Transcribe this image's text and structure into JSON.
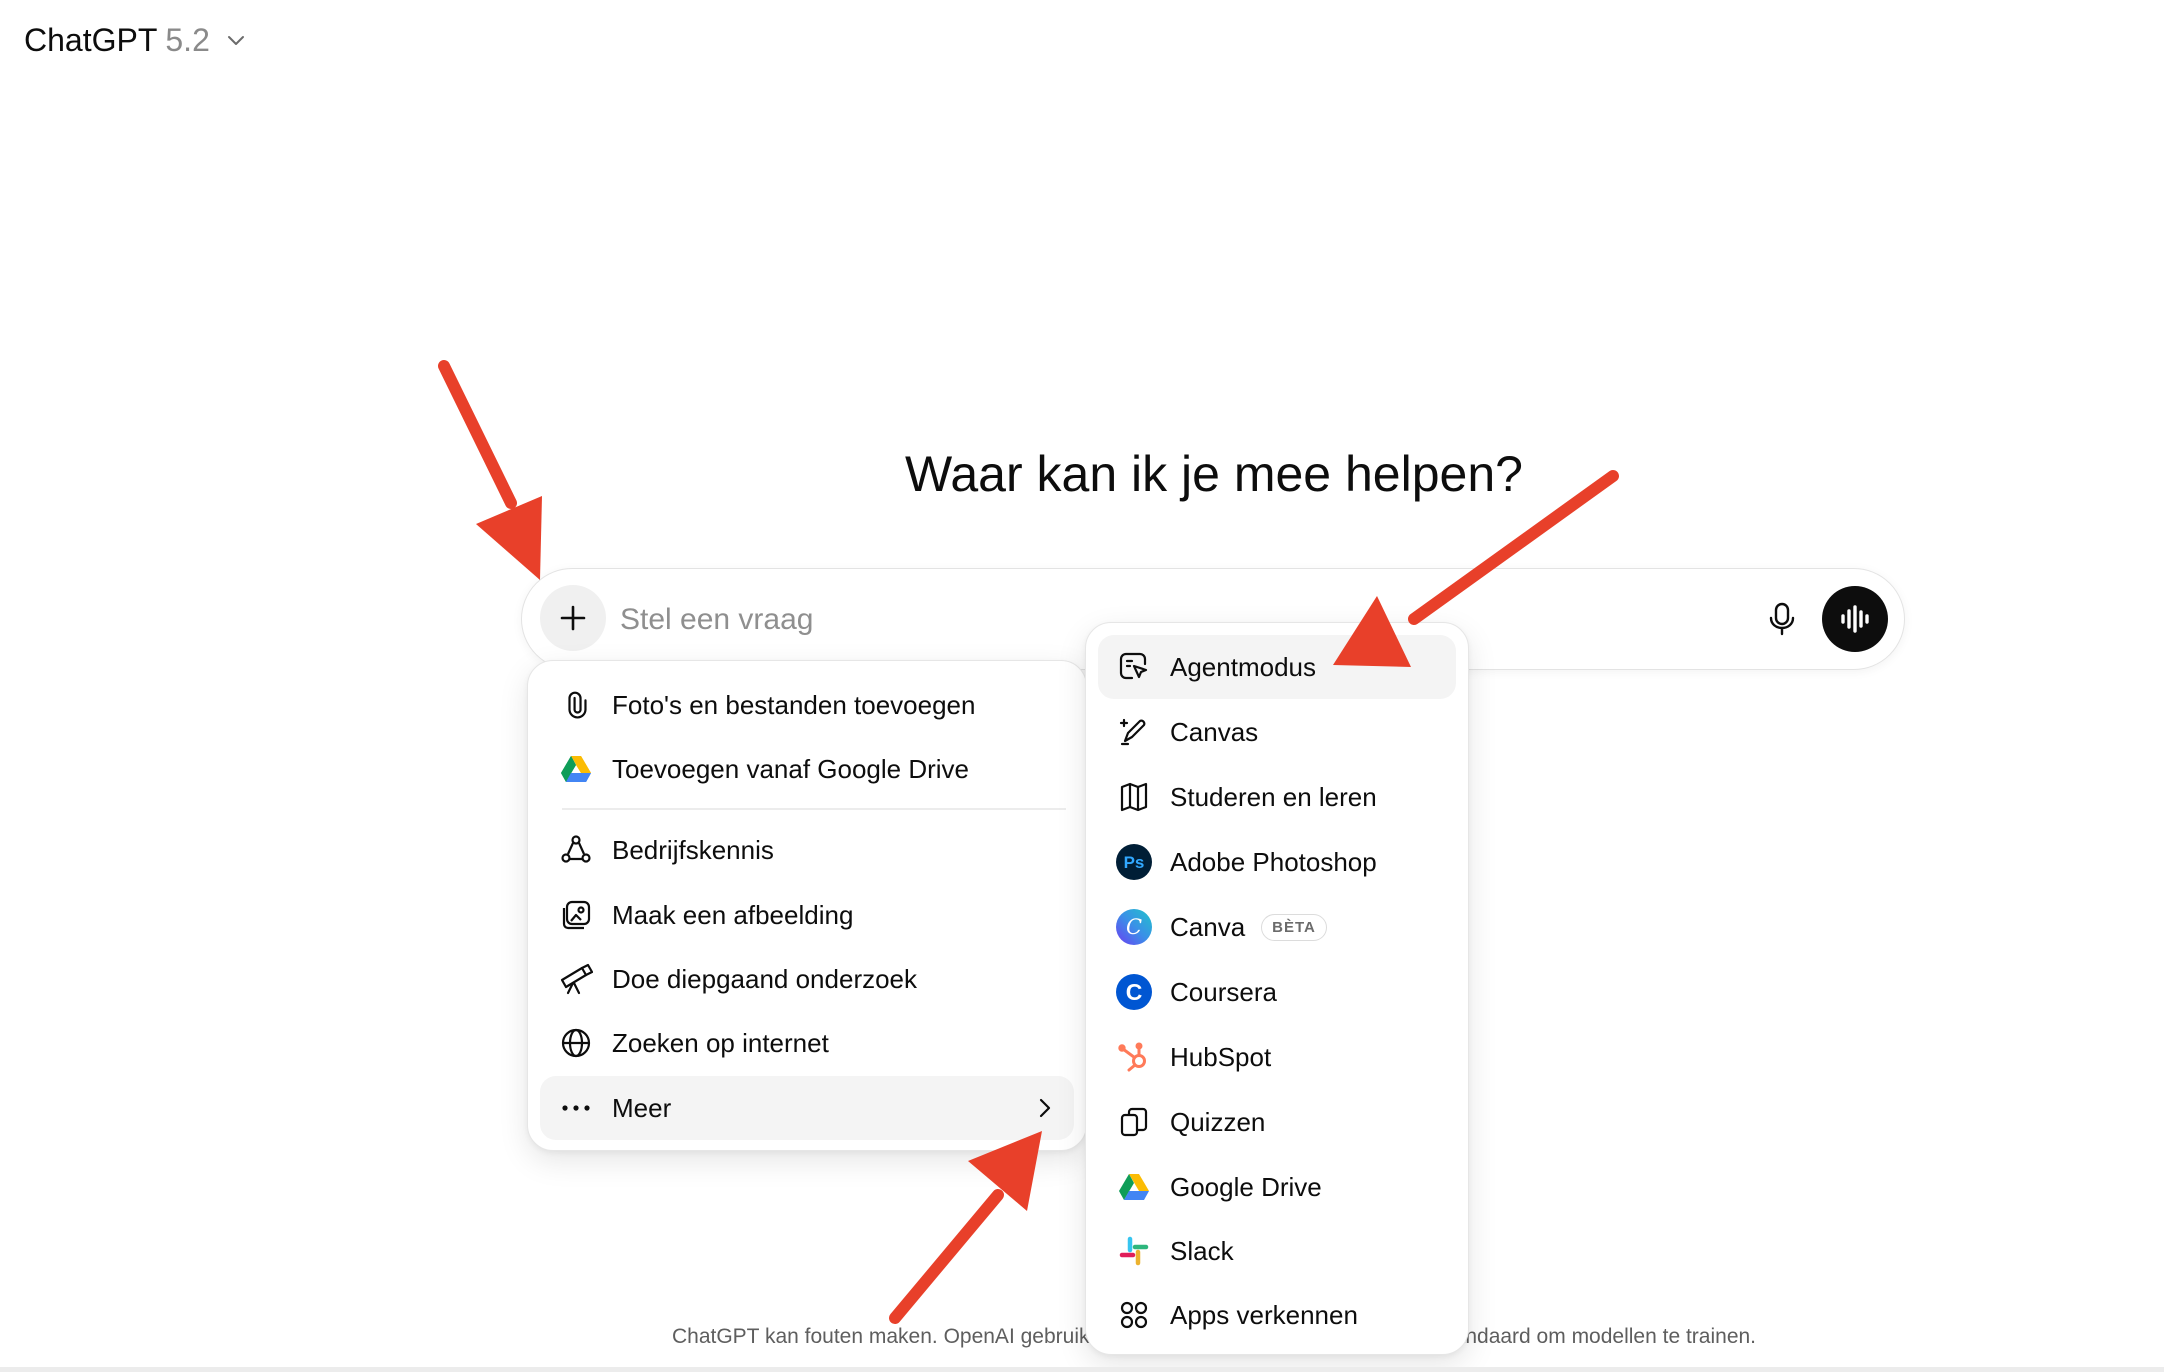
{
  "header": {
    "model_name": "ChatGPT",
    "model_version": "5.2"
  },
  "title": "Waar kan ik je mee helpen?",
  "composer": {
    "placeholder": "Stel een vraag"
  },
  "attach_menu": {
    "items": [
      {
        "label": "Foto's en bestanden toevoegen",
        "icon": "paperclip-icon"
      },
      {
        "label": "Toevoegen vanaf Google Drive",
        "icon": "google-drive-icon"
      },
      {
        "label": "Bedrijfskennis",
        "icon": "connectors-icon"
      },
      {
        "label": "Maak een afbeelding",
        "icon": "image-icon"
      },
      {
        "label": "Doe diepgaand onderzoek",
        "icon": "telescope-icon"
      },
      {
        "label": "Zoeken op internet",
        "icon": "globe-icon"
      },
      {
        "label": "Meer",
        "icon": "more-dots-icon"
      }
    ]
  },
  "apps_menu": {
    "items": [
      {
        "label": "Agentmodus",
        "icon": "agent-cursor-icon"
      },
      {
        "label": "Canvas",
        "icon": "canvas-pen-icon"
      },
      {
        "label": "Studeren en leren",
        "icon": "book-icon"
      },
      {
        "label": "Adobe Photoshop",
        "icon": "photoshop-icon",
        "icon_text": "Ps"
      },
      {
        "label": "Canva",
        "icon": "canva-icon",
        "badge": "BÈTA",
        "icon_text": "C"
      },
      {
        "label": "Coursera",
        "icon": "coursera-icon",
        "icon_text": "C"
      },
      {
        "label": "HubSpot",
        "icon": "hubspot-icon"
      },
      {
        "label": "Quizzen",
        "icon": "quiz-cards-icon"
      },
      {
        "label": "Google Drive",
        "icon": "google-drive-icon"
      },
      {
        "label": "Slack",
        "icon": "slack-icon"
      },
      {
        "label": "Apps verkennen",
        "icon": "apps-grid-icon"
      }
    ]
  },
  "footer": {
    "disclaimer": "ChatGPT kan fouten maken. OpenAI gebruikt je gesprekken in de werkruimte niet standaard om modellen te trainen."
  },
  "colors": {
    "annotation_arrow": "#e8402a",
    "voice_button": "#0d0d0d",
    "photoshop": "#001e36",
    "coursera": "#0056d2",
    "hubspot": "#ff7a59"
  }
}
